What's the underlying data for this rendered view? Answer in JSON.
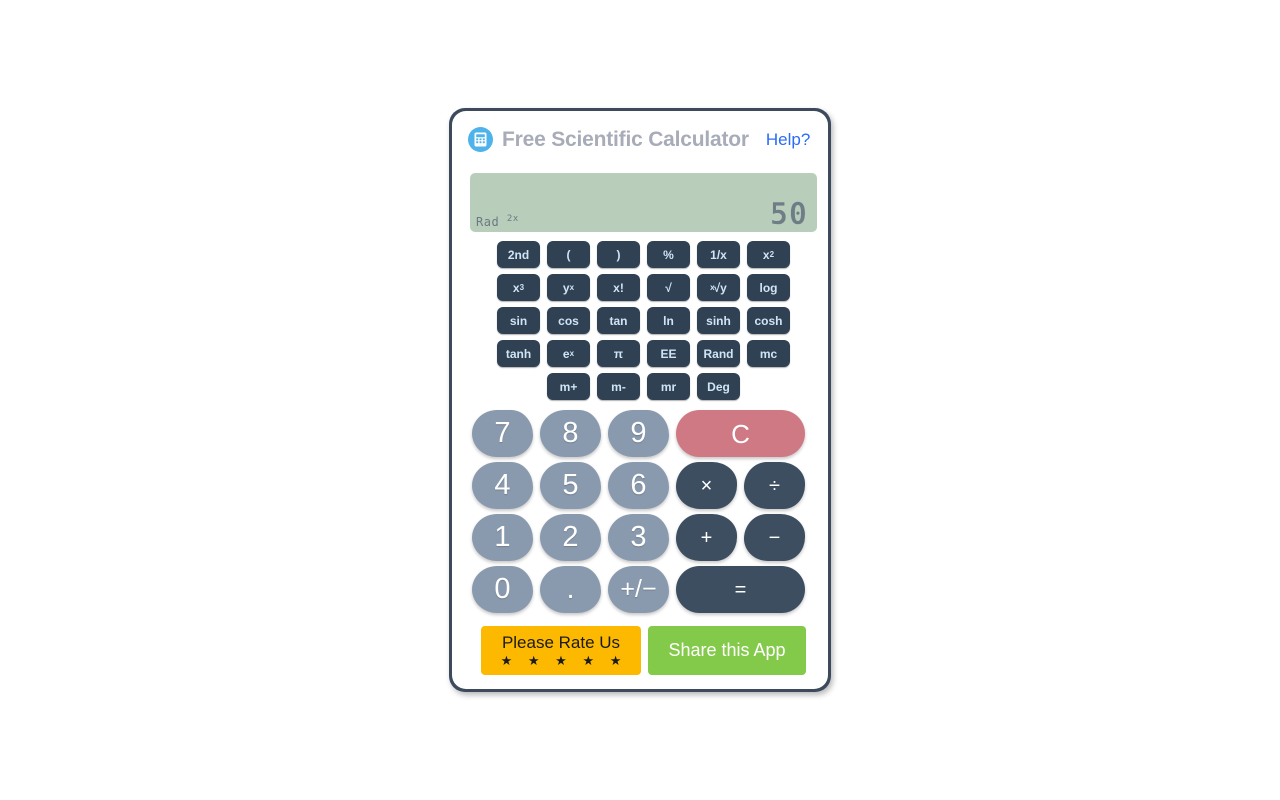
{
  "app": {
    "title": "Free Scientific Calculator",
    "help_label": "Help?",
    "icon": "calculator-icon",
    "accent_blue": "#4eb3ea",
    "title_color": "#a8acb8",
    "link_color": "#2b6cf5"
  },
  "display": {
    "value": "50",
    "mode": "Rad",
    "mode_suffix": "2x",
    "background": "#b9cdbb",
    "text_color": "#6f7d86"
  },
  "scientific_keys": {
    "row1": [
      "2nd",
      "(",
      ")",
      "%",
      "1/x",
      "x²"
    ],
    "row2": [
      "x³",
      "yˣ",
      "x!",
      "√",
      "ˣ√y",
      "log"
    ],
    "row3": [
      "sin",
      "cos",
      "tan",
      "ln",
      "sinh",
      "cosh"
    ],
    "row4": [
      "tanh",
      "eˣ",
      "π",
      "EE",
      "Rand",
      "mc"
    ],
    "row5": [
      "m+",
      "m-",
      "mr",
      "Deg"
    ],
    "labels": {
      "second": "2nd",
      "paren_open": "(",
      "paren_close": ")",
      "percent": "%",
      "reciprocal": "1/x",
      "square_base": "x",
      "square_exp": "2",
      "cube_base": "x",
      "cube_exp": "3",
      "ypowx_base": "y",
      "ypowx_exp": "x",
      "factorial": "x!",
      "sqrt": "√",
      "xroot_pre": "x",
      "xroot_body": "√y",
      "log": "log",
      "sin": "sin",
      "cos": "cos",
      "tan": "tan",
      "ln": "ln",
      "sinh": "sinh",
      "cosh": "cosh",
      "tanh": "tanh",
      "epowx_base": "e",
      "epowx_exp": "x",
      "pi": "π",
      "ee": "EE",
      "rand": "Rand",
      "mc": "mc",
      "mplus": "m+",
      "mminus": "m-",
      "mr": "mr",
      "deg": "Deg"
    },
    "key_background": "#2f4152",
    "key_text_color": "#cfe4f5"
  },
  "numeric_keys": {
    "seven": "7",
    "eight": "8",
    "nine": "9",
    "clear": "C",
    "four": "4",
    "five": "5",
    "six": "6",
    "multiply": "×",
    "divide": "÷",
    "one": "1",
    "two": "2",
    "three": "3",
    "plus": "+",
    "minus": "−",
    "zero": "0",
    "decimal": ".",
    "sign_toggle": "+/−",
    "equals": "=",
    "number_color": "#8a9aae",
    "operator_color": "#3d4e60",
    "clear_color": "#cf7985"
  },
  "footer": {
    "rate_label": "Please Rate Us",
    "rate_stars": "★ ★ ★ ★ ★",
    "rate_color": "#fcb900",
    "share_label": "Share this App",
    "share_color": "#84ca4a"
  }
}
